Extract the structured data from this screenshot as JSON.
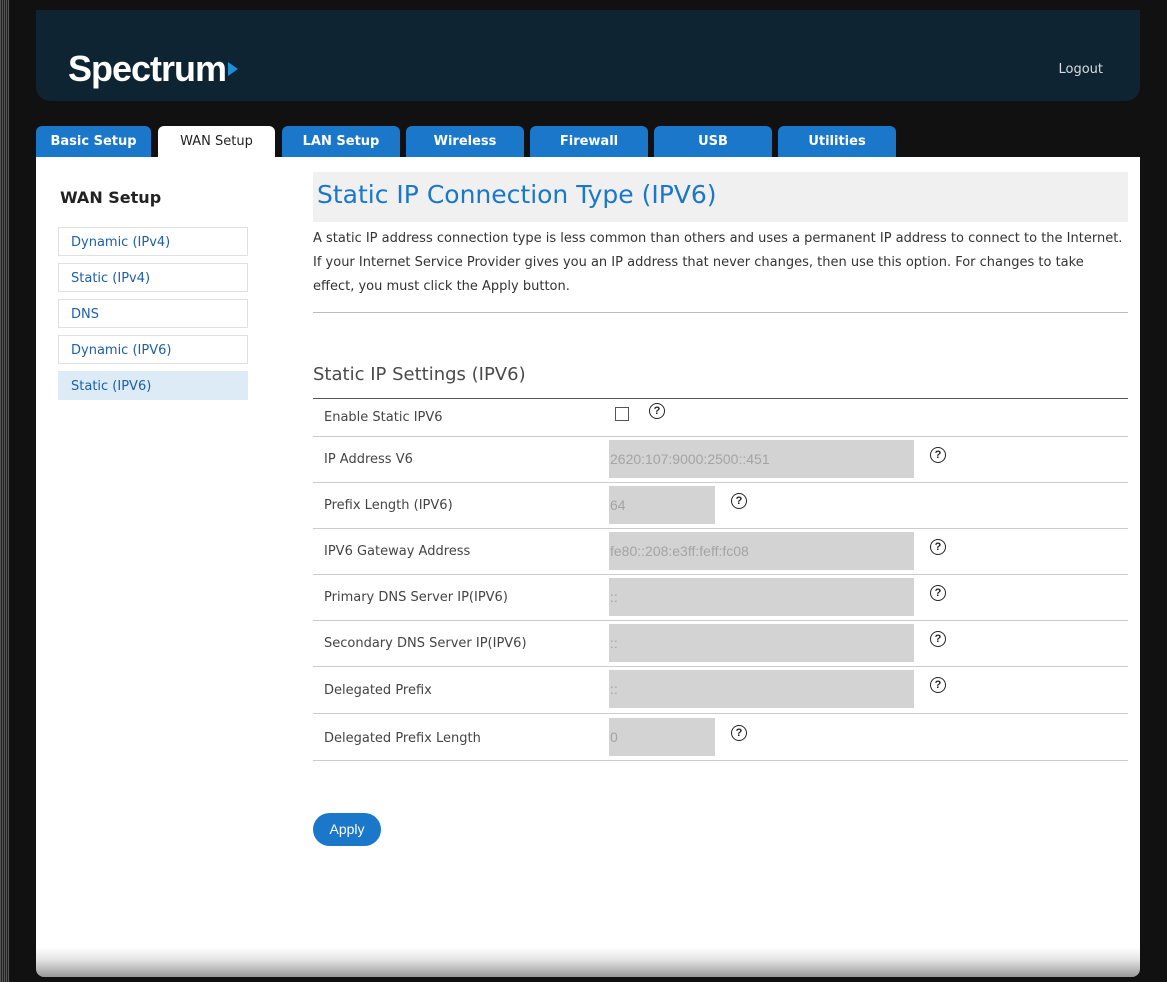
{
  "brand": {
    "name": "Spectrum",
    "accent": "#1a77c9"
  },
  "header": {
    "logout": "Logout"
  },
  "tabs": [
    {
      "label": "Basic Setup"
    },
    {
      "label": "WAN Setup",
      "active": true
    },
    {
      "label": "LAN Setup"
    },
    {
      "label": "Wireless"
    },
    {
      "label": "Firewall"
    },
    {
      "label": "USB"
    },
    {
      "label": "Utilities"
    }
  ],
  "sidebar": {
    "title": "WAN Setup",
    "items": [
      {
        "label": "Dynamic (IPv4)"
      },
      {
        "label": "Static (IPv4)"
      },
      {
        "label": "DNS"
      },
      {
        "label": "Dynamic (IPV6)"
      },
      {
        "label": "Static (IPV6)",
        "active": true
      }
    ]
  },
  "main": {
    "title": "Static IP Connection Type (IPV6)",
    "intro": "A static IP address connection type is less common than others and uses a permanent IP address to connect to the Internet. If your Internet Service Provider gives you an IP address that never changes, then use this option. For changes to take effect, you must click the Apply button.",
    "section_title": "Static IP Settings (IPV6)",
    "fields": [
      {
        "label": "Enable Static IPV6",
        "type": "checkbox",
        "checked": false
      },
      {
        "label": "IP Address V6",
        "value": "2620:107:9000:2500::451"
      },
      {
        "label": "Prefix Length (IPV6)",
        "value": "64"
      },
      {
        "label": "IPV6 Gateway Address",
        "value": "fe80::208:e3ff:feff:fc08"
      },
      {
        "label": "Primary DNS Server IP(IPV6)",
        "value": "::"
      },
      {
        "label": "Secondary DNS Server IP(IPV6)",
        "value": "::"
      },
      {
        "label": "Delegated Prefix",
        "value": "::"
      },
      {
        "label": "Delegated Prefix Length",
        "value": "0"
      }
    ],
    "help_icon": "?",
    "apply_label": "Apply"
  }
}
